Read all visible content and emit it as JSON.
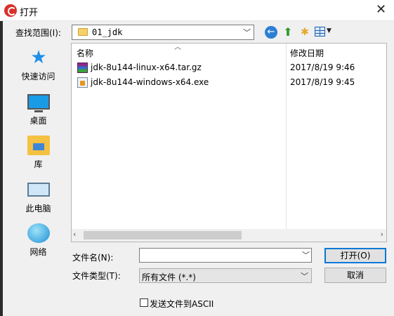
{
  "window": {
    "title": "打开",
    "close_glyph": "✕"
  },
  "toolbar": {
    "look_in_label": "查找范围(I):",
    "look_in_value": "01_jdk",
    "back_icon": "back-icon",
    "up_icon": "up-folder-icon",
    "new_folder_icon": "new-folder-icon",
    "view_menu_icon": "view-menu-icon"
  },
  "places": [
    {
      "label": "快速访问",
      "icon": "quick-access-star-icon"
    },
    {
      "label": "桌面",
      "icon": "desktop-icon"
    },
    {
      "label": "库",
      "icon": "library-icon"
    },
    {
      "label": "此电脑",
      "icon": "this-pc-icon"
    },
    {
      "label": "网络",
      "icon": "network-icon"
    }
  ],
  "file_list": {
    "columns": [
      "名称",
      "修改日期"
    ],
    "rows": [
      {
        "name": "jdk-8u144-linux-x64.tar.gz",
        "date": "2017/8/19 9:46",
        "icon": "archive-icon"
      },
      {
        "name": "jdk-8u144-windows-x64.exe",
        "date": "2017/8/19 9:45",
        "icon": "exe-icon"
      }
    ]
  },
  "filename": {
    "label": "文件名(N):",
    "value": ""
  },
  "filetype": {
    "label": "文件类型(T):",
    "value": "所有文件 (*.*)"
  },
  "buttons": {
    "open": "打开(O)",
    "cancel": "取消"
  },
  "ascii_checkbox": {
    "label": "发送文件到ASCII",
    "checked": false
  },
  "colors": {
    "accent": "#0078d7",
    "dialog_bg": "#f0f0f0"
  }
}
